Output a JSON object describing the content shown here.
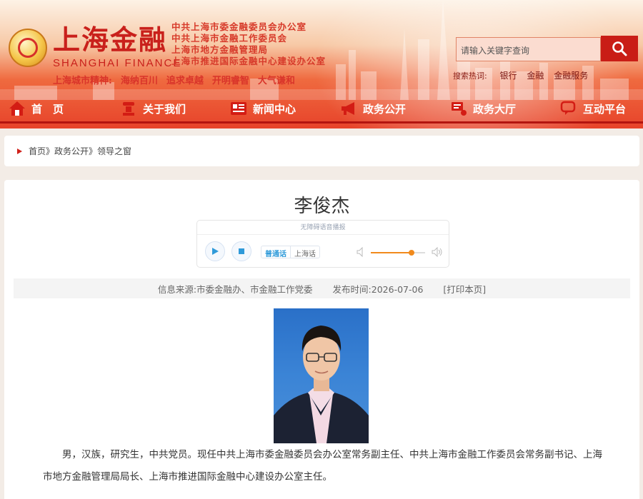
{
  "header": {
    "site_title": "上海金融",
    "site_title_en": "SHANGHAI FINANCE",
    "org_lines": [
      "中共上海市委金融委员会办公室",
      "中共上海市金融工作委员会",
      "上海市地方金融管理局",
      "上海市推进国际金融中心建设办公室"
    ],
    "slogan_label": "上海城市精神:",
    "slogan_items": [
      "海纳百川",
      "追求卓越",
      "开明睿智",
      "大气谦和"
    ],
    "search": {
      "placeholder": "请输入关键字查询"
    },
    "hot_label": "搜索热词:",
    "hot_keywords": [
      "银行",
      "金融",
      "金融服务"
    ]
  },
  "nav": {
    "items": [
      {
        "label": "首　页",
        "icon": "home-icon"
      },
      {
        "label": "关于我们",
        "icon": "podium-icon"
      },
      {
        "label": "新闻中心",
        "icon": "newspaper-icon"
      },
      {
        "label": "政务公开",
        "icon": "megaphone-icon"
      },
      {
        "label": "政务大厅",
        "icon": "service-icon"
      },
      {
        "label": "互动平台",
        "icon": "chat-icon"
      }
    ]
  },
  "breadcrumb": {
    "text": "首页》政务公开》领导之窗"
  },
  "article": {
    "title": "李俊杰",
    "player": {
      "hint": "无障碍语音播报",
      "lang_mandarin": "普通话",
      "lang_shanghai": "上海话",
      "volume": 0.75
    },
    "meta": {
      "source": "信息来源:市委金融办、市金融工作党委",
      "date": "发布时间:2026-07-06",
      "print": "[打印本页]"
    },
    "body": "男，汉族，研究生，中共党员。现任中共上海市委金融委员会办公室常务副主任、中共上海市金融工作委员会常务副书记、上海市地方金融管理局局长、上海市推进国际金融中心建设办公室主任。"
  },
  "colors": {
    "brand_red": "#c9201b",
    "nav_red": "#e7432a",
    "accent_orange": "#f18a1c",
    "link_blue": "#2f9ad9"
  }
}
